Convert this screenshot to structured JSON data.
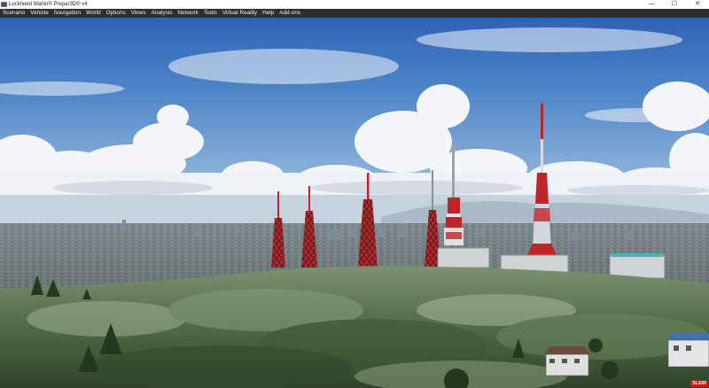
{
  "window": {
    "title": "Lockheed Martin® Prepar3D® v4",
    "controls": {
      "minimize": "—",
      "maximize": "☐",
      "close": "✕"
    }
  },
  "menu": {
    "items": [
      "Scenario",
      "Vehicle",
      "Navigation",
      "World",
      "Options",
      "Views",
      "Analysis",
      "Network",
      "Tools",
      "Virtual Reality",
      "Help",
      "Add-ons"
    ]
  },
  "status": {
    "slew": "SLEW"
  },
  "colors": {
    "sky_top": "#2e63b6",
    "sky_horizon": "#a9c3df",
    "tower_red": "#c0242a",
    "menubar": "#2e2e2e"
  }
}
